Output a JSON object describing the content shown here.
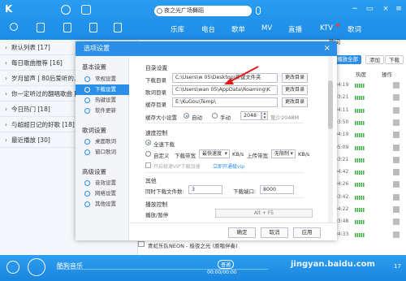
{
  "app": {
    "search_text": "夜之光广场舞蹈",
    "nav_tabs": [
      "乐库",
      "电台",
      "歌单",
      "MV",
      "直播",
      "KTV",
      "歌词"
    ],
    "ktv_dot_color": "#ff3b30",
    "sidebar_lists": [
      {
        "label": "默认列表 [17]"
      },
      {
        "label": "每日歌曲推荐 [16]"
      },
      {
        "label": "岁月留声 | 80后爱听的... [24]"
      },
      {
        "label": "你一定听过的翻唱歌曲 [14]"
      },
      {
        "label": "今日热门 [18]"
      },
      {
        "label": "与超超日记的好歌 [18]"
      },
      {
        "label": "最近播放 [30]"
      }
    ],
    "right_header": "歌词",
    "actions": {
      "play_all": "播放全部",
      "add": "添加",
      "download": "下载"
    },
    "columns": {
      "hot": "热度",
      "operate": "操作"
    },
    "track_times": [
      "04:19",
      "03:21",
      "04:11",
      "03:50",
      "04:19",
      "05:09",
      "03:21",
      "04:42",
      "04:26",
      "03:42",
      "04:22",
      "03:48",
      "04:33"
    ],
    "bottom_track": "青虹乐队NEON - 极夜之光 (原唱伴奏)",
    "player": {
      "now_playing": "酷狗音乐",
      "time": "00:00/00:00",
      "quality": "普通",
      "count": "17"
    },
    "watermark": "jingyan.baidu.com"
  },
  "dialog": {
    "title": "选项设置",
    "close": "×",
    "nav_groups": [
      {
        "title": "基本设置",
        "items": [
          "常规设置",
          "下载设置",
          "热键设置",
          "软件更新"
        ]
      },
      {
        "title": "歌词设置",
        "items": [
          "桌面歌词",
          "窗口歌词"
        ]
      },
      {
        "title": "高级设置",
        "items": [
          "音效设置",
          "网络设置",
          "其他设置"
        ]
      }
    ],
    "active_item": "下载设置",
    "sections": {
      "directory": "目录设置",
      "download_dir_label": "下载目录",
      "download_dir_value": "C:\\Users\\w        05\\Desktop\\新建文件夹",
      "lyrics_dir_label": "歌词目录",
      "lyrics_dir_value": "C:\\Users\\wan        05\\AppData\\Roaming\\K",
      "cache_dir_label": "缓存目录",
      "cache_dir_value": "E:\\KuGou\\Temp\\",
      "change_btn": "更改目录",
      "cache_size_label": "缓存大小设置",
      "auto": "自动",
      "manual": "手动",
      "cache_size_value": "2048",
      "cache_hint": "至少2048M",
      "speed": "速度控制",
      "full_speed": "全速下载",
      "custom": "自定义",
      "dl_speed_label": "下载带宽",
      "dl_speed_value": "最快速度",
      "dl_unit": "KB/s",
      "ul_speed_label": "上传带宽",
      "ul_speed_value": "无限制",
      "ul_unit": "KB/s",
      "vip_option": "开启极速VIP下载加速",
      "vip_link": "立即开通极vip",
      "other": "其他",
      "sim_files_label": "同时下载文件数:",
      "sim_files_value": "3",
      "port_label": "下载端口:",
      "port_value": "8000",
      "playback": "播放控制",
      "play_pause_label": "播放/暂停",
      "play_pause_hotkey": "Alt + F5"
    },
    "footer": {
      "ok": "确定",
      "cancel": "取消",
      "apply": "应用"
    }
  },
  "colors": {
    "accent": "#2a8fe8",
    "arrow": "#e0191f"
  }
}
